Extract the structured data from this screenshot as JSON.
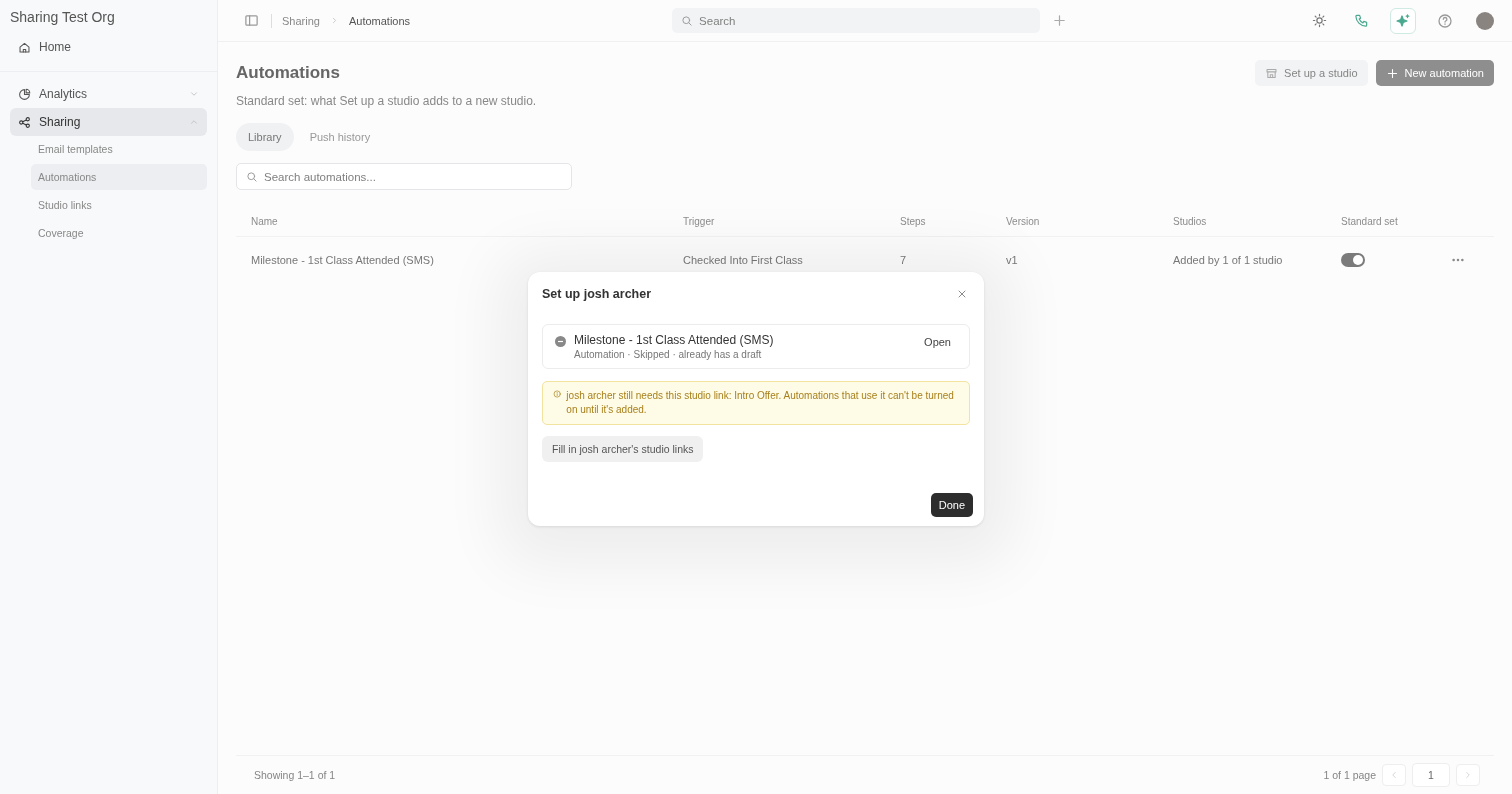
{
  "sidebar": {
    "org": "Sharing Test Org",
    "home": {
      "label": "Home",
      "selected": false
    },
    "sections": [
      {
        "label": "Analytics",
        "expanded": false,
        "selected": false
      },
      {
        "label": "Sharing",
        "expanded": true,
        "selected": true,
        "children": [
          {
            "label": "Email templates",
            "selected": false
          },
          {
            "label": "Automations",
            "selected": true
          },
          {
            "label": "Studio links",
            "selected": false
          },
          {
            "label": "Coverage",
            "selected": false
          }
        ]
      }
    ]
  },
  "topbar": {
    "breadcrumb": [
      "Sharing",
      "Automations"
    ],
    "search": {
      "placeholder": "Search"
    }
  },
  "page": {
    "title": "Automations",
    "subtitle": "Standard set: what Set up a studio adds to a new studio.",
    "buttons": [
      "Set up a studio",
      "New automation"
    ],
    "tabs": [
      {
        "label": "Library",
        "selected": true
      },
      {
        "label": "Push history",
        "selected": false
      }
    ],
    "search": {
      "placeholder": "Search automations..."
    }
  },
  "table": {
    "columns": [
      "Name",
      "Trigger",
      "Steps",
      "Version",
      "Studios",
      "Standard set"
    ],
    "rows": [
      {
        "name": "Milestone - 1st Class Attended (SMS)",
        "trigger": "Checked Into First Class",
        "steps": "7",
        "version": "v1",
        "studios": "Added by 1 of 1 studio",
        "standard_set": true
      }
    ]
  },
  "footer": {
    "showing": "Showing 1–1 of 1",
    "pages": "1 of 1 page",
    "page": "1"
  },
  "dialog": {
    "title": "Set up josh archer",
    "items": [
      {
        "title": "Milestone - 1st Class Attended (SMS)",
        "detail": "Automation · Skipped · already has a draft",
        "action": "Open"
      }
    ],
    "warning": "josh archer still needs this studio link: Intro Offer. Automations that use it can't be turned on until it's added.",
    "fill_button": "Fill in josh archer's studio links",
    "done": "Done"
  }
}
